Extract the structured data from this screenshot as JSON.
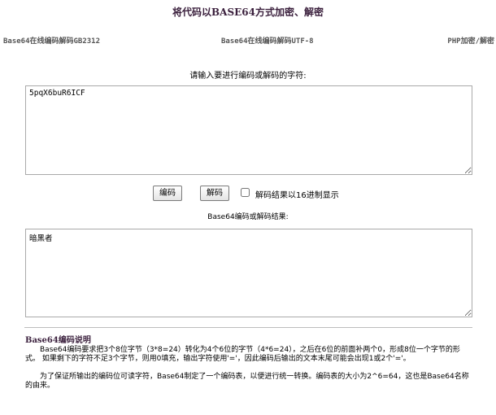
{
  "page": {
    "title": "将代码以BASE64方式加密、解密"
  },
  "nav": {
    "gb2312": "Base64在线编码解码GB2312",
    "utf8": "Base64在线编码解码UTF-8",
    "php": "PHP加密/解密"
  },
  "form": {
    "prompt": "请输入要进行编码或解码的字符:",
    "input_value": "5pqX6buR6ICF",
    "encode_label": "编码",
    "decode_label": "解码",
    "hex_checkbox_checked": false,
    "hex_label": "解码结果以16进制显示",
    "result_label": "Base64编码或解码结果:",
    "output_value": "暗黑者"
  },
  "description": {
    "title": "Base64编码说明",
    "paragraph1": "Base64编码要求把3个8位字节（3*8=24）转化为4个6位的字节（4*6=24），之后在6位的前面补两个0，形成8位一个字节的形式。 如果剩下的字符不足3个字节，则用0填充，输出字符使用'='，因此编码后输出的文本末尾可能会出现1或2个'='。",
    "paragraph2": "为了保证所输出的编码位可读字符，Base64制定了一个编码表，以便进行统一转换。编码表的大小为2^6=64，这也是Base64名称的由来。"
  },
  "colors": {
    "title": "#3a1f3c",
    "nav_text": "#555555",
    "divider": "#bdbdbd"
  }
}
